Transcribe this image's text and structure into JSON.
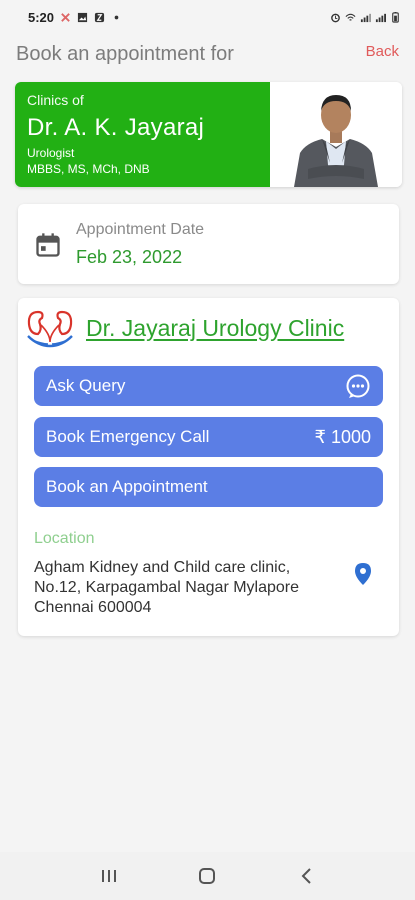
{
  "status_bar": {
    "time": "5:20",
    "icons": [
      "notification-icon",
      "image-icon",
      "app-icon",
      "dot-icon",
      "alarm-icon",
      "wifi-icon",
      "signal-icon",
      "signal-icon",
      "battery-icon"
    ]
  },
  "header": {
    "title": "Book an appointment for",
    "back_label": "Back"
  },
  "doctor": {
    "clinics_of": "Clinics of",
    "name": "Dr. A. K. Jayaraj",
    "specialty": "Urologist",
    "qualifications": "MBBS, MS, MCh, DNB"
  },
  "appointment": {
    "label": "Appointment Date",
    "date": "Feb 23, 2022"
  },
  "clinic": {
    "name": "Dr. Jayaraj Urology Clinic",
    "ask_query_label": "Ask Query",
    "emergency_label": "Book Emergency Call",
    "emergency_price": "₹ 1000",
    "book_appointment_label": "Book an Appointment",
    "location_label": "Location",
    "address": "Agham Kidney and Child care clinic, No.12, Karpagambal Nagar Mylapore Chennai 600004"
  },
  "colors": {
    "brand_green": "#22b014",
    "button_blue": "#5b7ee5",
    "back_red": "#e05a5a",
    "link_green": "#2ea32e"
  }
}
